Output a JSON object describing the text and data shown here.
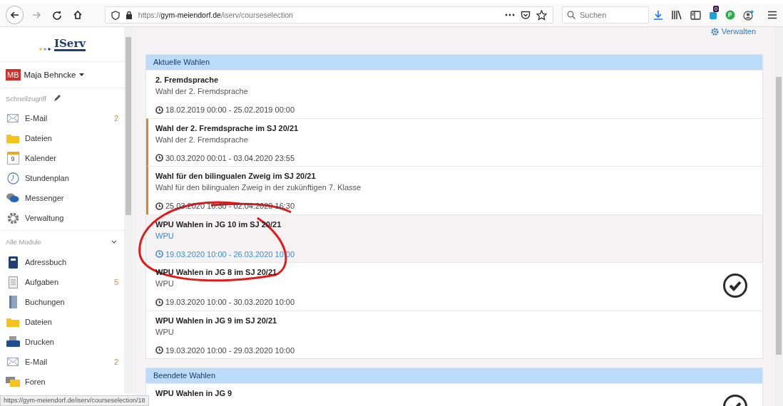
{
  "browser": {
    "url_scheme": "https://",
    "url_host": "gym-meiendorf.de",
    "url_path": "/iserv/courseselection",
    "search": {
      "placeholder": "Suchen"
    },
    "extension_badge": "0"
  },
  "sidebar": {
    "logo": "IServ",
    "user": {
      "initials": "MB",
      "name": "Maja Behncke"
    },
    "quick_title": "Schnellzugriff",
    "quick": [
      {
        "kind": "mail",
        "label": "E-Mail",
        "count": "2"
      },
      {
        "kind": "folder",
        "label": "Dateien"
      },
      {
        "kind": "calendar",
        "label": "Kalender",
        "icon_text": "9"
      },
      {
        "kind": "clock",
        "label": "Stundenplan"
      },
      {
        "kind": "chat",
        "label": "Messenger"
      },
      {
        "kind": "gear",
        "label": "Verwaltung"
      }
    ],
    "modules_title": "Alle Module",
    "modules": [
      {
        "kind": "book",
        "label": "Adressbuch"
      },
      {
        "kind": "clipboard",
        "label": "Aufgaben",
        "count": "5"
      },
      {
        "kind": "binder",
        "label": "Buchungen"
      },
      {
        "kind": "folder",
        "label": "Dateien"
      },
      {
        "kind": "printer",
        "label": "Drucken"
      },
      {
        "kind": "mail",
        "label": "E-Mail",
        "count": "2"
      },
      {
        "kind": "forum",
        "label": "Foren"
      }
    ]
  },
  "manage_link": "Verwalten",
  "sections": [
    {
      "title": "Aktuelle Wahlen",
      "items": [
        {
          "title": "2. Fremdsprache",
          "subtitle": "Wahl der 2. Fremdsprache",
          "period": "18.02.2019 00:00 - 25.02.2019 00:00",
          "marked": false,
          "selected": false,
          "done": false
        },
        {
          "title": "Wahl der 2. Fremdsprache im SJ 20/21",
          "subtitle": "Wahl der 2. Fremdsprache",
          "period": "30.03.2020 00:01 - 03.04.2020 23:55",
          "marked": true,
          "selected": false,
          "done": false
        },
        {
          "title": "Wahl für den bilingualen Zweig im SJ 20/21",
          "subtitle": "Wahl für den bilingualen Zweig in der zukünftigen 7. Klasse",
          "period": "25.03.2020 16:30 - 02.04.2020 16:30",
          "marked": true,
          "selected": false,
          "done": false
        },
        {
          "title": "WPU Wahlen in JG 10 im SJ 20/21",
          "subtitle": "WPU",
          "period": "19.03.2020 10:00 - 26.03.2020 10:00",
          "marked": false,
          "selected": true,
          "done": false
        },
        {
          "title": "WPU Wahlen in JG 8 im SJ 20/21",
          "subtitle": "WPU",
          "period": "19.03.2020 10:00 - 30.03.2020 10:00",
          "marked": false,
          "selected": false,
          "done": true
        },
        {
          "title": "WPU Wahlen in JG 9 im SJ 20/21",
          "subtitle": "WPU",
          "period": "19.03.2020 10:00 - 29.03.2020 10:00",
          "marked": false,
          "selected": false,
          "done": false
        }
      ]
    },
    {
      "title": "Beendete Wahlen",
      "items": [
        {
          "title": "WPU Wahlen in JG 9",
          "marked": false,
          "selected": false,
          "done": true
        }
      ]
    }
  ],
  "status_url": "https://gym-meiendorf.de/iserv/courseselection/18"
}
